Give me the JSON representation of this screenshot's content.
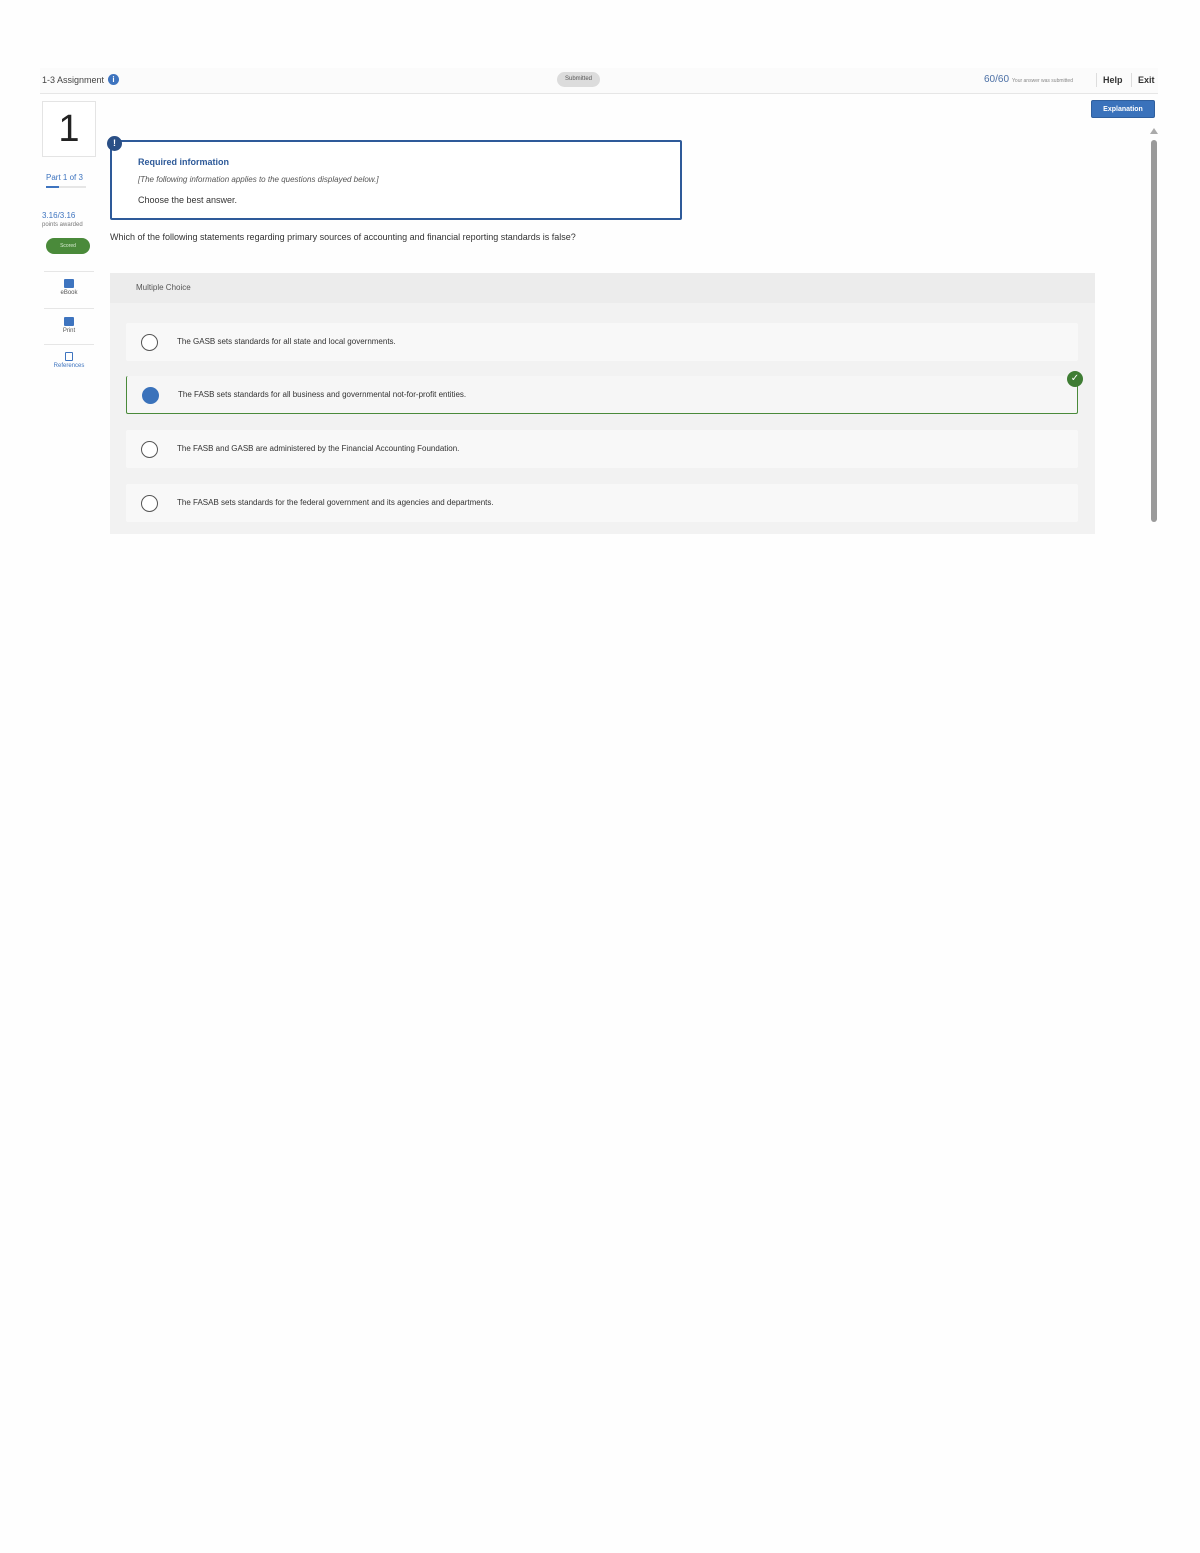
{
  "header": {
    "assignment_title": "1-3 Assignment",
    "status": "Submitted",
    "score": "60/60",
    "score_note": "Your answer was submitted",
    "help": "Help",
    "exit": "Exit"
  },
  "rail": {
    "question_number": "1",
    "part": "Part 1 of 3",
    "part_progress": 0.33,
    "points": "3.16/3.16",
    "points_label": "points awarded",
    "scored": "Scored",
    "tools": [
      {
        "label": "eBook",
        "icon": "book-icon"
      },
      {
        "label": "Print",
        "icon": "print-icon"
      },
      {
        "label": "References",
        "icon": "references-icon"
      }
    ]
  },
  "explanation_button": "Explanation",
  "required_info": {
    "badge": "!",
    "title": "Required information",
    "subtitle": "[The following information applies to the questions displayed below.]",
    "instruction": "Choose the best answer."
  },
  "question": "Which of the following statements regarding primary sources of accounting and financial reporting standards is false?",
  "multiple_choice": {
    "heading": "Multiple Choice",
    "selected_index": 1,
    "options": [
      "The GASB sets standards for all state and local governments.",
      "The FASB sets standards for all business and governmental not-for-profit entities.",
      "The FASB and GASB are administered by the Financial Accounting Foundation.",
      "The FASAB sets standards for the federal government and its agencies and departments."
    ]
  },
  "colors": {
    "accent": "#3a72bb",
    "correct": "#3f7d34",
    "required_border": "#2e5a99"
  }
}
